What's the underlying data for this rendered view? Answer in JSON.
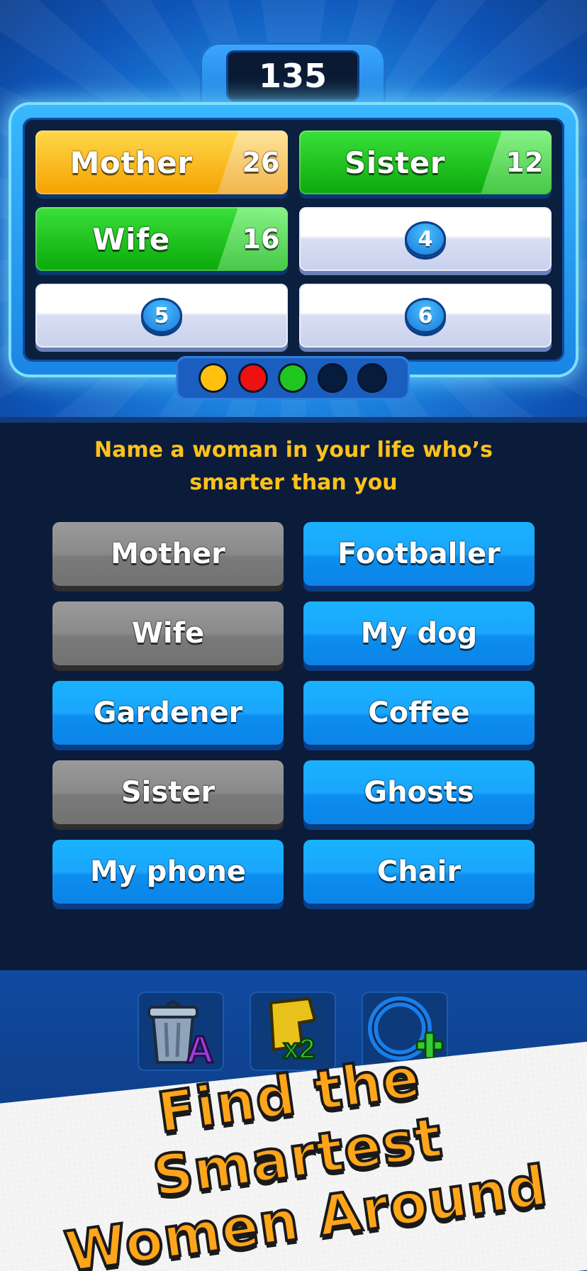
{
  "score": "135",
  "board": {
    "tiles": [
      {
        "answer": "Mother",
        "points": "26"
      },
      {
        "answer": "Sister",
        "points": "12"
      },
      {
        "answer": "Wife",
        "points": "16"
      },
      {
        "number": "4"
      },
      {
        "number": "5"
      },
      {
        "number": "6"
      }
    ]
  },
  "strikes": {
    "colors": [
      "#ffc10d",
      "#ee1111",
      "#1fc61f",
      "#071c3d",
      "#071c3d"
    ]
  },
  "question": {
    "line1": "Name a woman in your life who’s",
    "line2": "smarter than you"
  },
  "options": [
    {
      "label": "Mother",
      "state": "used"
    },
    {
      "label": "Footballer",
      "state": "active"
    },
    {
      "label": "Wife",
      "state": "used"
    },
    {
      "label": "My dog",
      "state": "active"
    },
    {
      "label": "Gardener",
      "state": "active"
    },
    {
      "label": "Coffee",
      "state": "active"
    },
    {
      "label": "Sister",
      "state": "used"
    },
    {
      "label": "Ghosts",
      "state": "active"
    },
    {
      "label": "My phone",
      "state": "active"
    },
    {
      "label": "Chair",
      "state": "active"
    }
  ],
  "powerups": {
    "trash_letter": "A",
    "double_label": "x2"
  },
  "banner": {
    "line1": "Find the Smartest",
    "line2": "Women Around"
  }
}
